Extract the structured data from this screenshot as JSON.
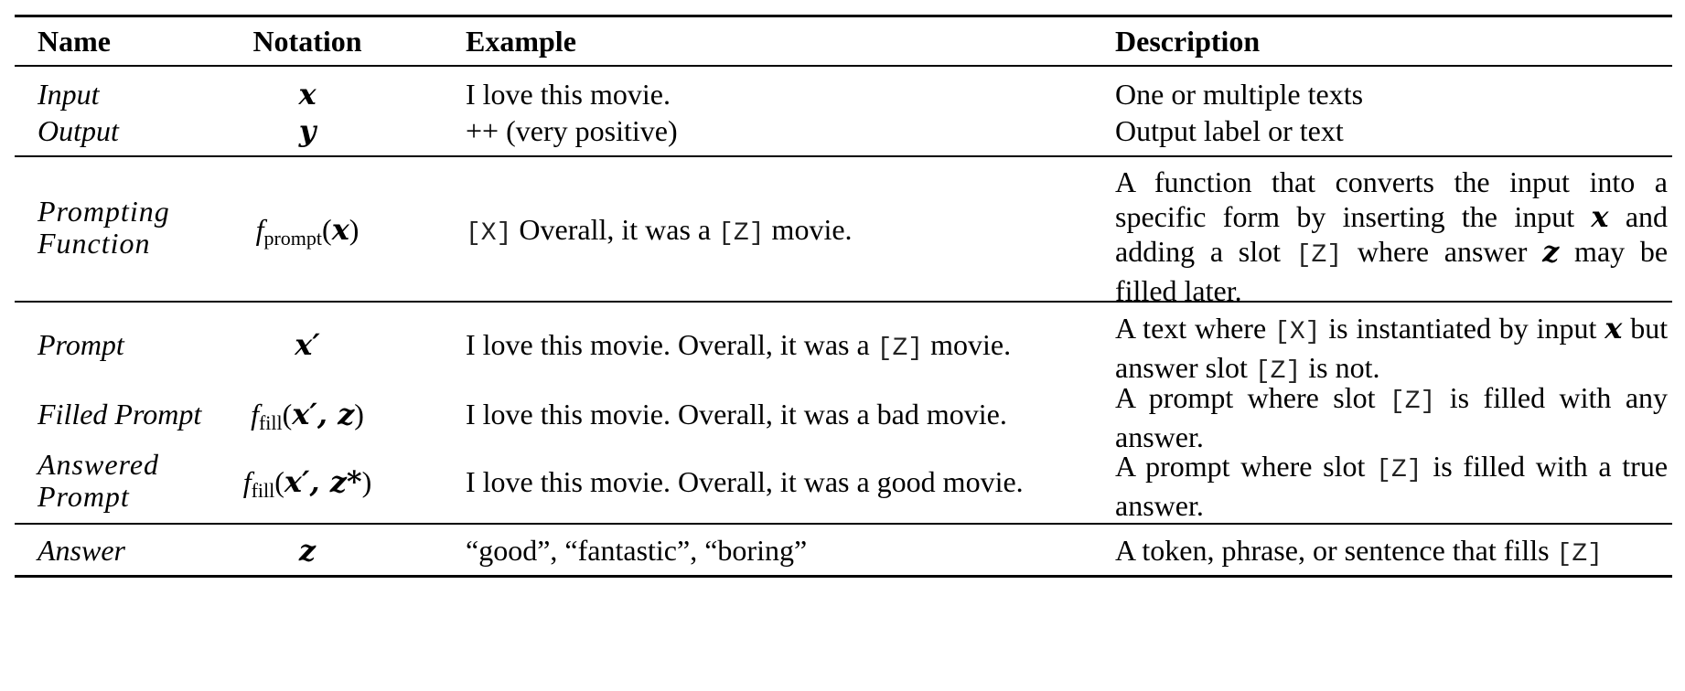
{
  "table": {
    "headers": {
      "name": "Name",
      "notation": "Notation",
      "example": "Example",
      "description": "Description"
    },
    "rows": [
      {
        "name": "Input",
        "notation": "x",
        "example": "I love this movie.",
        "description": "One or multiple texts"
      },
      {
        "name": "Output",
        "notation": "y",
        "example": "++ (very positive)",
        "description": "Output label or text"
      },
      {
        "name_line1": "Prompting",
        "name_line2": "Function",
        "notation_f": "f",
        "notation_sub": "prompt",
        "notation_arg": "x",
        "example_x": "[X]",
        "example_mid": "Overall, it was a",
        "example_z": "[Z]",
        "example_end": "movie.",
        "description_p1": "A function that converts the input into a specific form by inserting the input",
        "description_x": "x",
        "description_p2": "and adding a slot",
        "description_z": "[Z]",
        "description_p3": "where answer",
        "description_zvar": "z",
        "description_p4": "may be filled later."
      },
      {
        "name": "Prompt",
        "notation": "x′",
        "example_pre": "I love this movie. Overall, it was a",
        "example_z": "[Z]",
        "example_end": "movie.",
        "description_p1": "A text where",
        "description_x": "[X]",
        "description_p2": "is instantiated by input",
        "description_xvar": "x",
        "description_p3": "but answer slot",
        "description_z": "[Z]",
        "description_p4": "is not."
      },
      {
        "name": "Filled Prompt",
        "notation_f": "f",
        "notation_sub": "fill",
        "notation_args": "x′, z",
        "example": "I love this movie. Overall, it was a bad movie.",
        "description_p1": "A prompt where slot",
        "description_z": "[Z]",
        "description_p2": "is filled with any answer."
      },
      {
        "name_line1": "Answered",
        "name_line2": "Prompt",
        "notation_f": "f",
        "notation_sub": "fill",
        "notation_args": "x′, z*",
        "example": "I love this movie. Overall, it was a good movie.",
        "description_p1": "A prompt where slot",
        "description_z": "[Z]",
        "description_p2": "is filled with a true answer."
      },
      {
        "name": "Answer",
        "notation": "z",
        "example": "“good”, “fantastic”, “boring”",
        "description_p1": "A token, phrase, or sentence that fills",
        "description_z": "[Z]"
      }
    ]
  }
}
